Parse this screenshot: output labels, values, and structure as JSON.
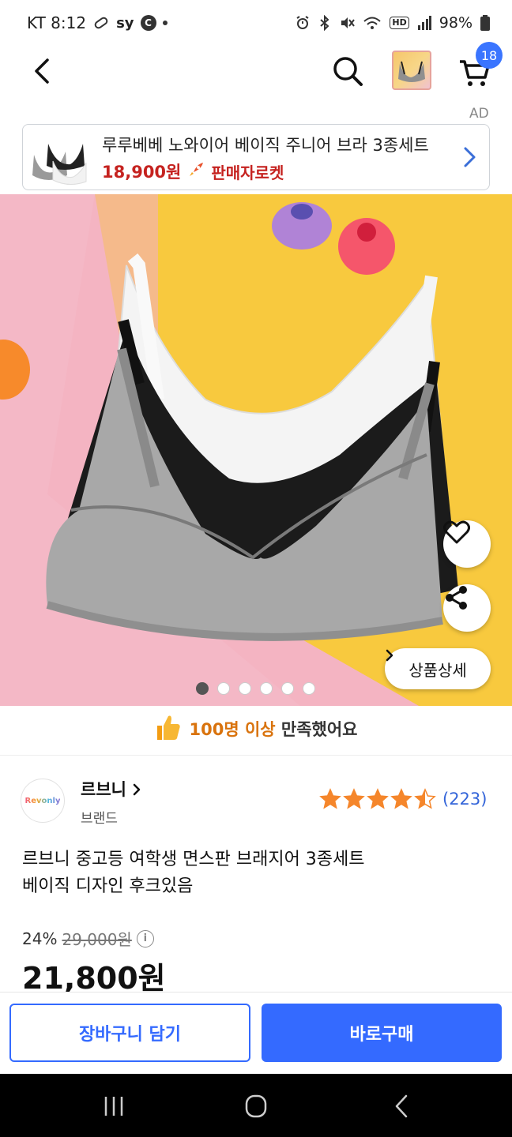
{
  "status_bar": {
    "carrier_time": "KT 8:12",
    "sy_label": "sy",
    "c_label": "C",
    "battery": "98%",
    "hd_label": "HD"
  },
  "nav": {
    "cart_count": "18"
  },
  "ad": {
    "label": "AD",
    "title": "루루베베 노와이어 베이직 주니어 브라 3종세트",
    "price": "18,900원",
    "rocket_label": "판매자로켓"
  },
  "gallery": {
    "detail_label": "상품상세",
    "dots_total": 6,
    "dots_active_index": 0
  },
  "satisfaction": {
    "highlight": "100명 이상",
    "text": "만족했어요"
  },
  "brand": {
    "name": "르브니",
    "subtitle": "브랜드",
    "logo_text": "Revonly",
    "rating": 4.5,
    "review_count": "(223)"
  },
  "product": {
    "title_line1": "르브니 중고등 여학생 면스판 브래지어 3종세트",
    "title_line2": "베이직 디자인 후크있음",
    "discount": "24%",
    "original_price": "29,000원",
    "price": "21,800원"
  },
  "actions": {
    "cart_label": "장바구니 담기",
    "buy_label": "바로구매"
  },
  "colors": {
    "accent_blue": "#346aff",
    "price_red": "#c5221f",
    "badge_blue": "#3a75ff"
  }
}
